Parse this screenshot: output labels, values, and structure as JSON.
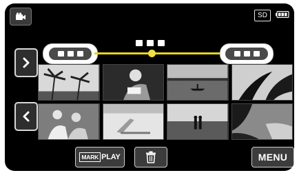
{
  "top_bar": {
    "camera_mode_icon": "video-camera-icon",
    "storage_label": "SD",
    "battery_icon": "battery-icon"
  },
  "date_slider": {
    "position_fraction": 0.45,
    "track_color": "#e8d31e",
    "start_pill_icon": "date-placeholder-icon",
    "end_pill_icon": "date-placeholder-icon",
    "current_date_icon": "date-placeholder-icon"
  },
  "navigation": {
    "next_icon": "chevron-right-icon",
    "prev_icon": "chevron-left-icon"
  },
  "thumbnails": [
    {
      "name": "thumb-palm-trees"
    },
    {
      "name": "thumb-woman-reading"
    },
    {
      "name": "thumb-lake-boat"
    },
    {
      "name": "thumb-palm-leaves"
    },
    {
      "name": "thumb-beach-people"
    },
    {
      "name": "thumb-beach-chair"
    },
    {
      "name": "thumb-couple-beach"
    },
    {
      "name": "thumb-coast-rocks"
    }
  ],
  "bottom_bar": {
    "markplay_mark": "MARK",
    "markplay_play": "PLAY",
    "delete_icon": "trash-icon",
    "menu_label": "MENU"
  }
}
